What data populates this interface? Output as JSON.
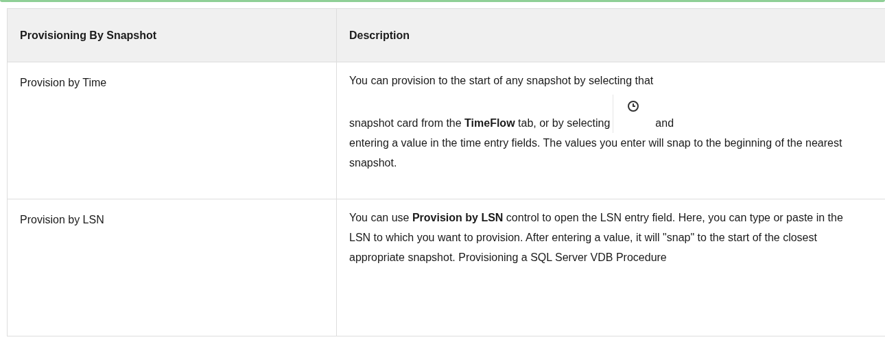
{
  "table": {
    "columns": [
      "Provisioning By Snapshot",
      "Description"
    ],
    "rows": [
      {
        "name": "Provision by Time",
        "description": [
          {
            "kind": "text",
            "text": "You can provision to the start of any snapshot by selecting that"
          },
          {
            "kind": "text",
            "text": "snapshot card from the **TimeFlow** tab, or by selecting"
          },
          {
            "kind": "icon"
          },
          {
            "kind": "text",
            "text": "and"
          },
          {
            "kind": "text",
            "text": "entering a value in the time entry fields. The values you enter will snap to the beginning of the nearest snapshot."
          }
        ]
      },
      {
        "name": "Provision by LSN",
        "description": [
          {
            "kind": "text",
            "text": "You can use **Provision by LSN** control to open the LSN entry field. Here, you can type or paste in the LSN to which you want to provision. After entering a value, it will \"snap\" to the start of the closest appropriate snapshot. Provisioning a SQL Server VDB Procedure"
          }
        ]
      }
    ]
  }
}
